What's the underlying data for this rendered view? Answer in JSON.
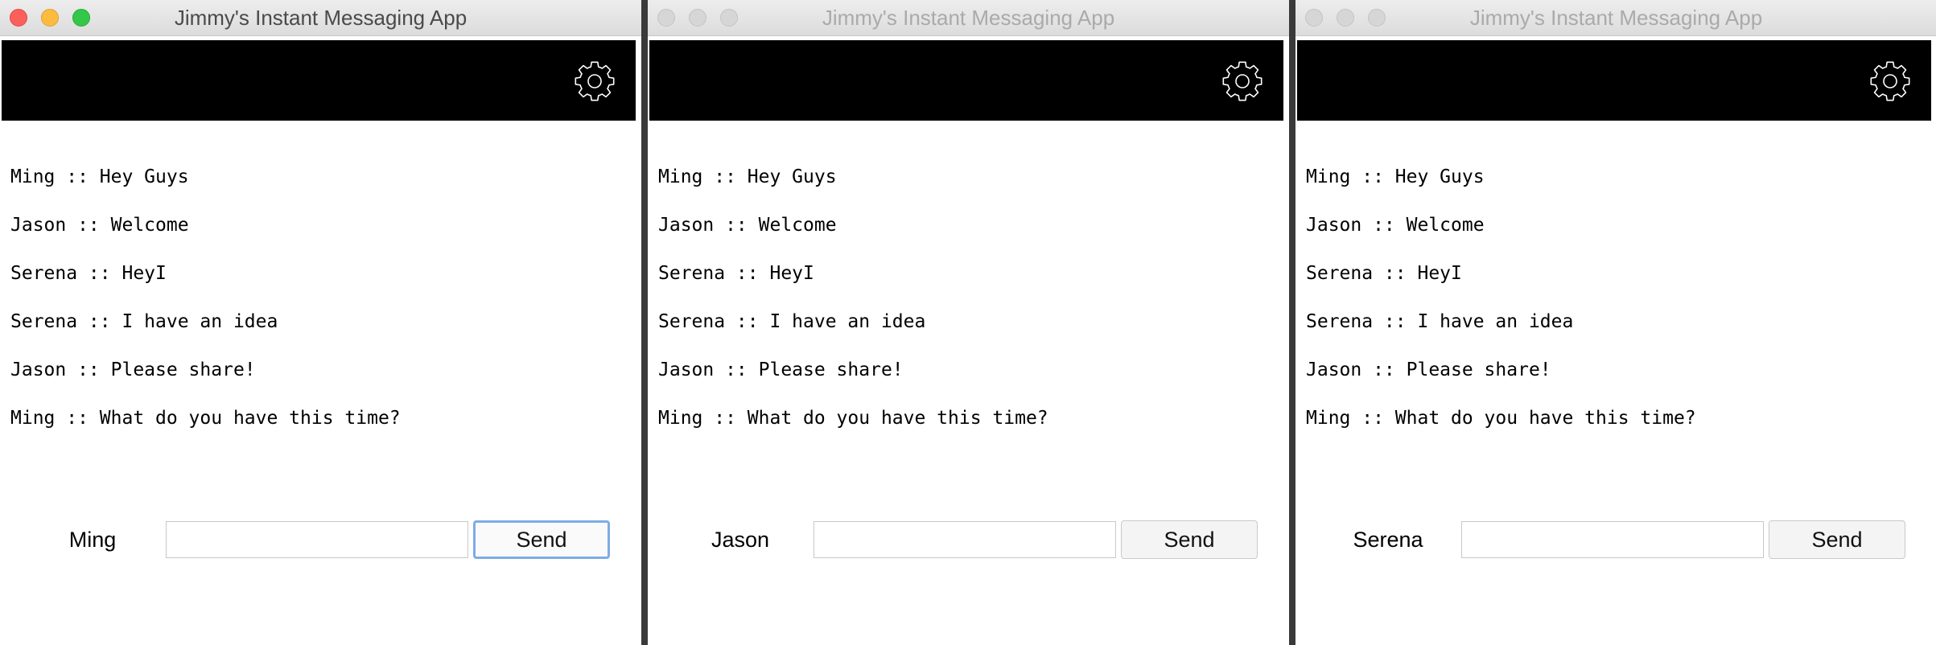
{
  "app": {
    "title": "Jimmy's Instant Messaging App"
  },
  "messages": [
    "Ming :: Hey Guys",
    "Jason :: Welcome",
    "Serena :: HeyI",
    "Serena :: I have an idea",
    "Jason :: Please share!",
    "Ming :: What do you have this time?"
  ],
  "windows": [
    {
      "user": "Ming",
      "state": "active",
      "input_value": "",
      "send_label": "Send"
    },
    {
      "user": "Jason",
      "state": "inactive",
      "input_value": "",
      "send_label": "Send"
    },
    {
      "user": "Serena",
      "state": "inactive",
      "input_value": "",
      "send_label": "Send"
    }
  ],
  "icons": {
    "settings": "gear-icon",
    "close": "close-button",
    "minimize": "minimize-button",
    "zoom": "zoom-button"
  },
  "colors": {
    "header_bar": "#000000",
    "close_active": "#fc605b",
    "minimize_active": "#fdbc40",
    "zoom_active": "#34c84a",
    "focus_ring": "#7fabe6"
  }
}
